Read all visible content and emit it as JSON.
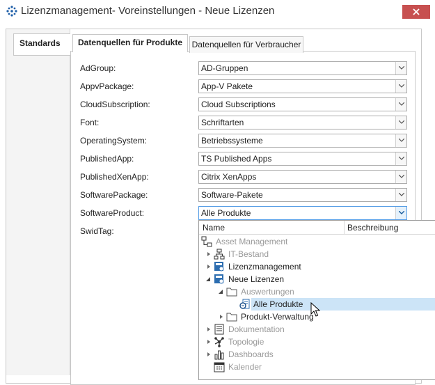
{
  "window": {
    "title": "Lizenzmanagement- Voreinstellungen - Neue Lizenzen",
    "close_color": "#c75050"
  },
  "left_tabs": [
    {
      "label": "Standards"
    }
  ],
  "tabs": [
    {
      "label": "Datenquellen für Produkte",
      "active": true
    },
    {
      "label": "Datenquellen für Verbraucher",
      "active": false
    }
  ],
  "fields": [
    {
      "label": "AdGroup:",
      "value": "AD-Gruppen"
    },
    {
      "label": "AppvPackage:",
      "value": "App-V Pakete"
    },
    {
      "label": "CloudSubscription:",
      "value": "Cloud Subscriptions"
    },
    {
      "label": "Font:",
      "value": "Schriftarten"
    },
    {
      "label": "OperatingSystem:",
      "value": "Betriebssysteme"
    },
    {
      "label": "PublishedApp:",
      "value": "TS Published Apps"
    },
    {
      "label": "PublishedXenApp:",
      "value": "Citrix XenApps"
    },
    {
      "label": "SoftwarePackage:",
      "value": "Software-Pakete"
    },
    {
      "label": "SoftwareProduct:",
      "value": "Alle Produkte",
      "open": true
    },
    {
      "label": "SwidTag:",
      "value": ""
    }
  ],
  "dropdown": {
    "columns": {
      "name": "Name",
      "description": "Beschreibung"
    },
    "tree": [
      {
        "label": "Asset Management",
        "icon": "hierarchy-icon",
        "muted": true
      },
      {
        "label": "IT-Bestand",
        "icon": "network-icon",
        "muted": true,
        "expander": "collapsed"
      },
      {
        "label": "Lizenzmanagement",
        "icon": "license-module-icon",
        "muted": false,
        "expander": "collapsed"
      },
      {
        "label": "Neue Lizenzen",
        "icon": "license-module-icon",
        "muted": false,
        "expander": "expanded"
      },
      {
        "label": "Auswertungen",
        "icon": "folder-icon",
        "muted": true,
        "expander": "expanded"
      },
      {
        "label": "Alle Produkte",
        "icon": "product-report-icon",
        "muted": false,
        "selected": true
      },
      {
        "label": "Produkt-Verwaltung",
        "icon": "folder-icon",
        "muted": false,
        "expander": "collapsed"
      },
      {
        "label": "Dokumentation",
        "icon": "document-icon",
        "muted": true,
        "expander": "collapsed"
      },
      {
        "label": "Topologie",
        "icon": "topology-icon",
        "muted": true,
        "expander": "collapsed"
      },
      {
        "label": "Dashboards",
        "icon": "bar-chart-icon",
        "muted": true,
        "expander": "collapsed"
      },
      {
        "label": "Kalender",
        "icon": "calendar-icon",
        "muted": true
      }
    ]
  },
  "colors": {
    "selection": "#cce4f7",
    "accent_border": "#569de5",
    "muted_text": "#9a9a9a"
  }
}
